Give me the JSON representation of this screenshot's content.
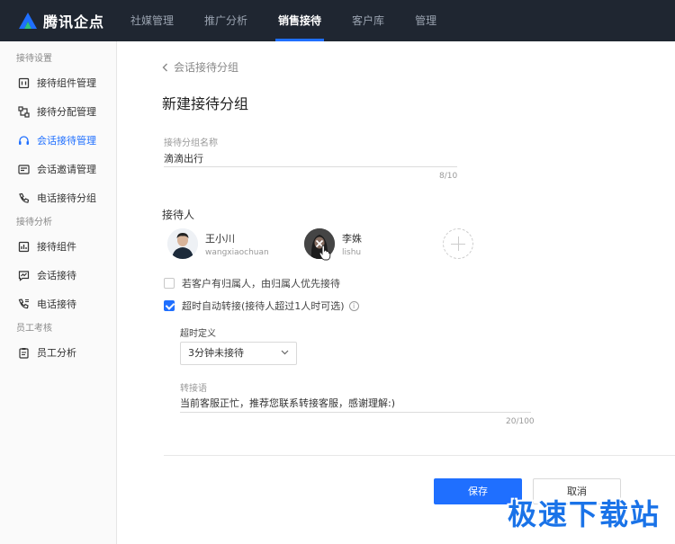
{
  "header": {
    "brand": "腾讯企点",
    "nav": [
      "社媒管理",
      "推广分析",
      "销售接待",
      "客户库",
      "管理"
    ],
    "active_nav": "销售接待"
  },
  "sidebar": {
    "groups": [
      {
        "title": "接待设置",
        "items": [
          {
            "label": "接待组件管理",
            "icon": "widget-icon"
          },
          {
            "label": "接待分配管理",
            "icon": "route-icon"
          },
          {
            "label": "会话接待管理",
            "icon": "headset-icon",
            "active": true
          },
          {
            "label": "会话邀请管理",
            "icon": "invite-icon"
          },
          {
            "label": "电话接待分组",
            "icon": "phone-icon"
          }
        ]
      },
      {
        "title": "接待分析",
        "items": [
          {
            "label": "接待组件",
            "icon": "widget-analysis-icon"
          },
          {
            "label": "会话接待",
            "icon": "chat-analysis-icon"
          },
          {
            "label": "电话接待",
            "icon": "phone-analysis-icon"
          }
        ]
      },
      {
        "title": "员工考核",
        "items": [
          {
            "label": "员工分析",
            "icon": "clipboard-icon"
          }
        ]
      }
    ]
  },
  "main": {
    "back_label": "会话接待分组",
    "title": "新建接待分组",
    "group_name": {
      "label": "接待分组名称",
      "value": "滴滴出行",
      "counter": "8/10"
    },
    "agents_title": "接待人",
    "agents": [
      {
        "name": "王小川",
        "id": "wangxiaochuan"
      },
      {
        "name": "李姝",
        "id": "lishu"
      }
    ],
    "options": [
      {
        "label": "若客户有归属人，由归属人优先接待",
        "checked": false
      },
      {
        "label": "超时自动转接(接待人超过1人时可选)",
        "checked": true
      }
    ],
    "timeout": {
      "label": "超时定义",
      "selected": "3分钟未接待"
    },
    "transfer": {
      "label": "转接语",
      "value": "当前客服正忙，推荐您联系转接客服，感谢理解:)",
      "counter": "20/100"
    },
    "save_label": "保存",
    "cancel_label": "取消"
  },
  "watermark": "极速下载站",
  "colors": {
    "accent": "#1f6fff",
    "topbar": "#1f2631"
  }
}
